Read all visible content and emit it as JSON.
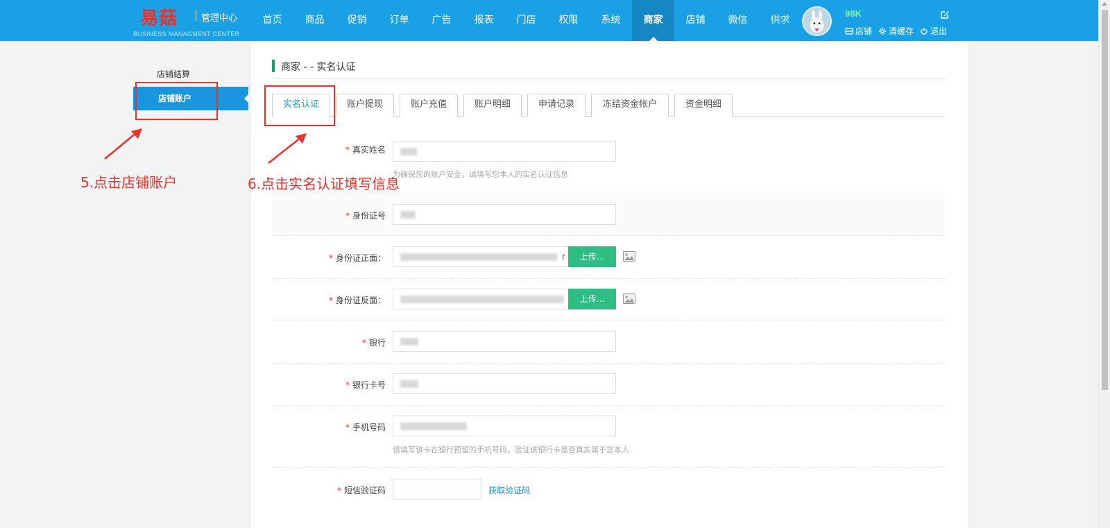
{
  "header": {
    "logo_text": "易菇",
    "subtitle": "管理中心",
    "subtitle_en": "BUSINESS MANAGMENT CENTER",
    "nav": [
      "首页",
      "商品",
      "促销",
      "订单",
      "广告",
      "报表",
      "门店",
      "权限",
      "系统",
      "商家",
      "店铺",
      "微信",
      "供求"
    ],
    "active_nav": "商家",
    "user_count": "98K",
    "links": [
      "店铺",
      "清缓存",
      "退出"
    ]
  },
  "sidebar": {
    "title": "店铺结算",
    "active_item": "店铺账户"
  },
  "main": {
    "breadcrumb": "商家 - - 实名认证",
    "tabs": [
      "实名认证",
      "账户提现",
      "账户充值",
      "账户明细",
      "申请记录",
      "冻结资金帐户",
      "资金明细"
    ],
    "active_tab": "实名认证",
    "form": {
      "real_name_label": "真实姓名",
      "real_name_hint": "为确保您的账户安全，请填写您本人的实名认证信息",
      "id_number_label": "身份证号",
      "id_front_label": "身份证正面：",
      "id_front_value_tail": "r",
      "id_back_label": "身份证反面：",
      "upload_label": "上传...",
      "bank_label": "银行",
      "card_number_label": "银行卡号",
      "phone_label": "手机号码",
      "phone_hint": "请填写该卡在银行预留的手机号码，验证该银行卡是否真实属于您本人",
      "sms_label": "短信验证码",
      "get_code_link": "获取验证码",
      "required_mark": "*"
    }
  },
  "annotations": {
    "step5": "5.点击店铺账户",
    "step6": "6.点击实名认证填写信息"
  },
  "colors": {
    "topbar": "#1aa1e5",
    "active_nav": "#1687c5",
    "accent": "#1a96df",
    "upload_button": "#2ebd84",
    "annotation": "#e8322b",
    "breadcrumb_bar": "#14a36a"
  }
}
